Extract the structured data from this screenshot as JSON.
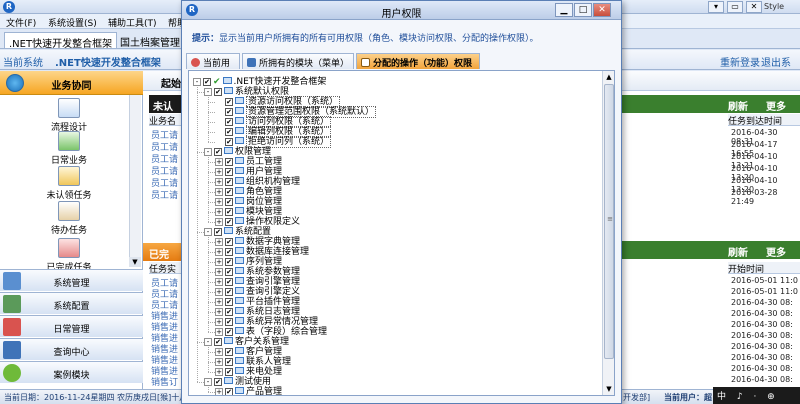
{
  "app": {
    "logo_letter": "R",
    "style_label": "Style",
    "window_buttons": [
      "▾",
      "▭",
      "✕"
    ]
  },
  "menubar": {
    "items": [
      "文件(F)",
      "系统设置(S)",
      "辅助工具(T)",
      "帮助"
    ]
  },
  "app_tabs": [
    ".NET快速开发整合框架",
    "国土档案管理"
  ],
  "sysbar": {
    "current_system_label": "当前系统",
    "system_name": ".NET快速开发整合框架",
    "relogin": "重新登录",
    "logout": "退出系统"
  },
  "leftnav": {
    "header": "业务协同",
    "items": [
      {
        "label": "流程设计",
        "icon": "flow-design-icon"
      },
      {
        "label": "日常业务",
        "icon": "daily-business-icon"
      },
      {
        "label": "未认领任务",
        "icon": "unclaimed-task-icon"
      },
      {
        "label": "待办任务",
        "icon": "todo-task-icon"
      },
      {
        "label": "已完成任务",
        "icon": "completed-task-icon"
      }
    ],
    "groups": [
      {
        "label": "系统管理",
        "icon": "system-manage-icon",
        "color": "#5a8fd0"
      },
      {
        "label": "系统配置",
        "icon": "system-config-icon",
        "color": "#5b9a5a"
      },
      {
        "label": "日常管理",
        "icon": "calendar-icon",
        "color": "#d9534f"
      },
      {
        "label": "查询中心",
        "icon": "query-center-icon",
        "color": "#3f73b8"
      },
      {
        "label": "案例模块",
        "icon": "case-module-icon",
        "color": "#6fba3a"
      }
    ]
  },
  "work": {
    "panel1": {
      "title": "起始",
      "subtitle": "未认",
      "col_left": "业务名",
      "col_right": "任务到达时间",
      "refresh": "刷新",
      "more": "更多>>",
      "rows_left": [
        "员工请",
        "员工请",
        "员工请",
        "员工请",
        "员工请",
        "员工请"
      ],
      "rows_right": [
        "2016-04-30 08:31",
        "2016-04-17 16:55",
        "2016-04-10 13:21",
        "2016-04-10 13:20",
        "2016-04-10 13:20",
        "2016-03-28 21:49"
      ]
    },
    "panel2": {
      "title": "已完",
      "col_left": "任务实",
      "col_right": "开始时间",
      "refresh": "刷新",
      "more": "更多>>",
      "rows_left": [
        "员工请",
        "员工请",
        "员工请",
        "销售进",
        "销售进",
        "销售进",
        "销售进",
        "销售进",
        "销售进",
        "销售订"
      ],
      "rows_right": [
        "2016-05-01 11:0",
        "2016-05-01 11:0",
        "2016-04-30 08:",
        "2016-04-30 08:",
        "2016-04-30 08:",
        "2016-04-30 08:",
        "2016-04-30 08:",
        "2016-04-30 08:",
        "2016-04-30 08:",
        "2016-04-30 08:"
      ]
    }
  },
  "statusbar": {
    "date": "当前日期：2016-11-24星期四 农历庚戌日[猴]十月",
    "dept": "开发部]",
    "user": "当前用户：超"
  },
  "ime": "中 ♪ · ⊕",
  "dialog": {
    "title": "用户权限",
    "tip_key": "提示：",
    "tip_text": "显示当前用户所拥有的所有可用权限（角色、模块访问权限、分配的操作权限）。",
    "tabs": [
      {
        "label": "当前用户",
        "icon_color": "#d9534f"
      },
      {
        "label": "所拥有的模块（菜单）",
        "icon_color": "#3f73b8"
      },
      {
        "label": "分配的操作（功能）权限",
        "icon_color": "#ffffff"
      }
    ],
    "tree": [
      {
        "level": 0,
        "label": ".NET快速开发整合框架",
        "exp": "-",
        "root": true
      },
      {
        "level": 1,
        "label": "系统默认权限",
        "exp": "-"
      },
      {
        "level": 2,
        "label": "资源访问权限（系统）",
        "highlight": true
      },
      {
        "level": 2,
        "label": "资源管理范围权限（系统默认）",
        "highlight": true
      },
      {
        "level": 2,
        "label": "访问列权限（系统）",
        "highlight": true
      },
      {
        "level": 2,
        "label": "编辑列权限（系统）",
        "highlight": true
      },
      {
        "level": 2,
        "label": "拒绝访问列（系统）",
        "highlight": true
      },
      {
        "level": 1,
        "label": "权限管理",
        "exp": "-"
      },
      {
        "level": 2,
        "label": "员工管理",
        "exp": "+"
      },
      {
        "level": 2,
        "label": "用户管理",
        "exp": "+"
      },
      {
        "level": 2,
        "label": "组织机构管理",
        "exp": "+"
      },
      {
        "level": 2,
        "label": "角色管理",
        "exp": "+"
      },
      {
        "level": 2,
        "label": "岗位管理",
        "exp": "+"
      },
      {
        "level": 2,
        "label": "模块管理",
        "exp": "+"
      },
      {
        "level": 2,
        "label": "操作权限定义",
        "exp": "+"
      },
      {
        "level": 1,
        "label": "系统配置",
        "exp": "-"
      },
      {
        "level": 2,
        "label": "数据字典管理",
        "exp": "+"
      },
      {
        "level": 2,
        "label": "数据库连接管理",
        "exp": "+"
      },
      {
        "level": 2,
        "label": "序列管理",
        "exp": "+"
      },
      {
        "level": 2,
        "label": "系统参数管理",
        "exp": "+"
      },
      {
        "level": 2,
        "label": "查询引擎管理",
        "exp": "+"
      },
      {
        "level": 2,
        "label": "查询引擎定义",
        "exp": "+"
      },
      {
        "level": 2,
        "label": "平台插件管理",
        "exp": "+"
      },
      {
        "level": 2,
        "label": "系统日志管理",
        "exp": "+"
      },
      {
        "level": 2,
        "label": "系统异常情况管理",
        "exp": "+"
      },
      {
        "level": 2,
        "label": "表（字段）综合管理",
        "exp": "+"
      },
      {
        "level": 1,
        "label": "客户关系管理",
        "exp": "-"
      },
      {
        "level": 2,
        "label": "客户管理",
        "exp": "+"
      },
      {
        "level": 2,
        "label": "联系人管理",
        "exp": "+"
      },
      {
        "level": 2,
        "label": "来电处理",
        "exp": "+"
      },
      {
        "level": 1,
        "label": "测试使用",
        "exp": "-"
      },
      {
        "level": 2,
        "label": "产品管理",
        "exp": "+"
      }
    ]
  }
}
